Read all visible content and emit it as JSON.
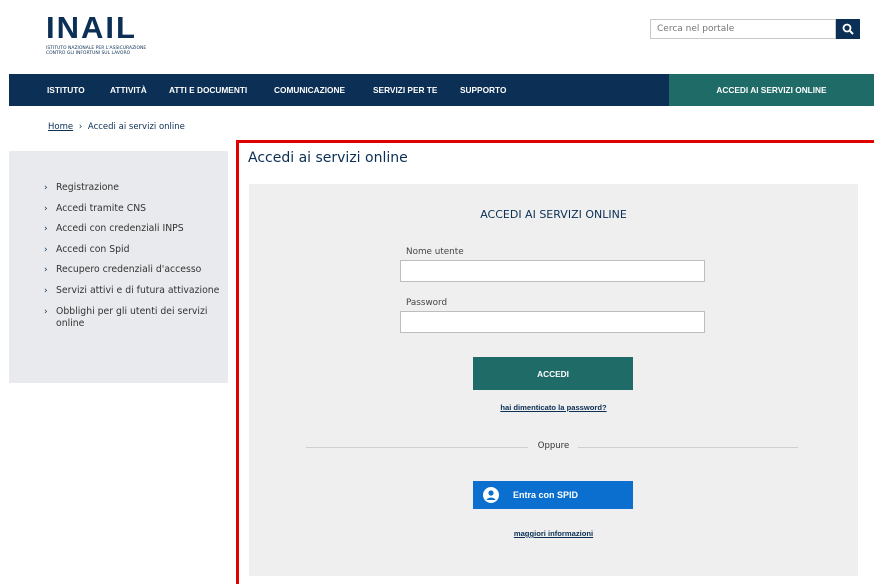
{
  "header": {
    "logo_text": "INAIL",
    "logo_subtitle": "ISTITUTO NAZIONALE PER L'ASSICURAZIONE CONTRO GLI INFORTUNI SUL LAVORO",
    "search_placeholder": "Cerca nel portale"
  },
  "nav": {
    "items": [
      "ISTITUTO",
      "ATTIVITÀ",
      "ATTI E DOCUMENTI",
      "COMUNICAZIONE",
      "SERVIZI PER TE",
      "SUPPORTO"
    ],
    "accedi_label": "ACCEDI AI SERVIZI ONLINE"
  },
  "breadcrumb": {
    "home": "Home",
    "separator": "›",
    "current": "Accedi ai servizi online"
  },
  "sidebar": {
    "items": [
      "Registrazione",
      "Accedi tramite CNS",
      "Accedi con credenziali INPS",
      "Accedi con Spid",
      "Recupero credenziali d'accesso",
      "Servizi attivi e di futura attivazione",
      "Obblighi per gli utenti dei servizi online"
    ]
  },
  "main": {
    "page_title": "Accedi ai servizi online",
    "panel_title": "ACCEDI AI SERVIZI ONLINE",
    "username_label": "Nome utente",
    "username_value": "",
    "password_label": "Password",
    "password_value": "",
    "accedi_button": "ACCEDI",
    "forgot_link": "hai dimenticato la password?",
    "oppure": "Oppure",
    "spid_button": "Entra con SPID",
    "more_info_link": "maggiori informazioni"
  },
  "colors": {
    "navy": "#0b2f55",
    "teal": "#1f6b67",
    "spid_blue": "#0b6fd0",
    "highlight_red": "#e10000"
  }
}
